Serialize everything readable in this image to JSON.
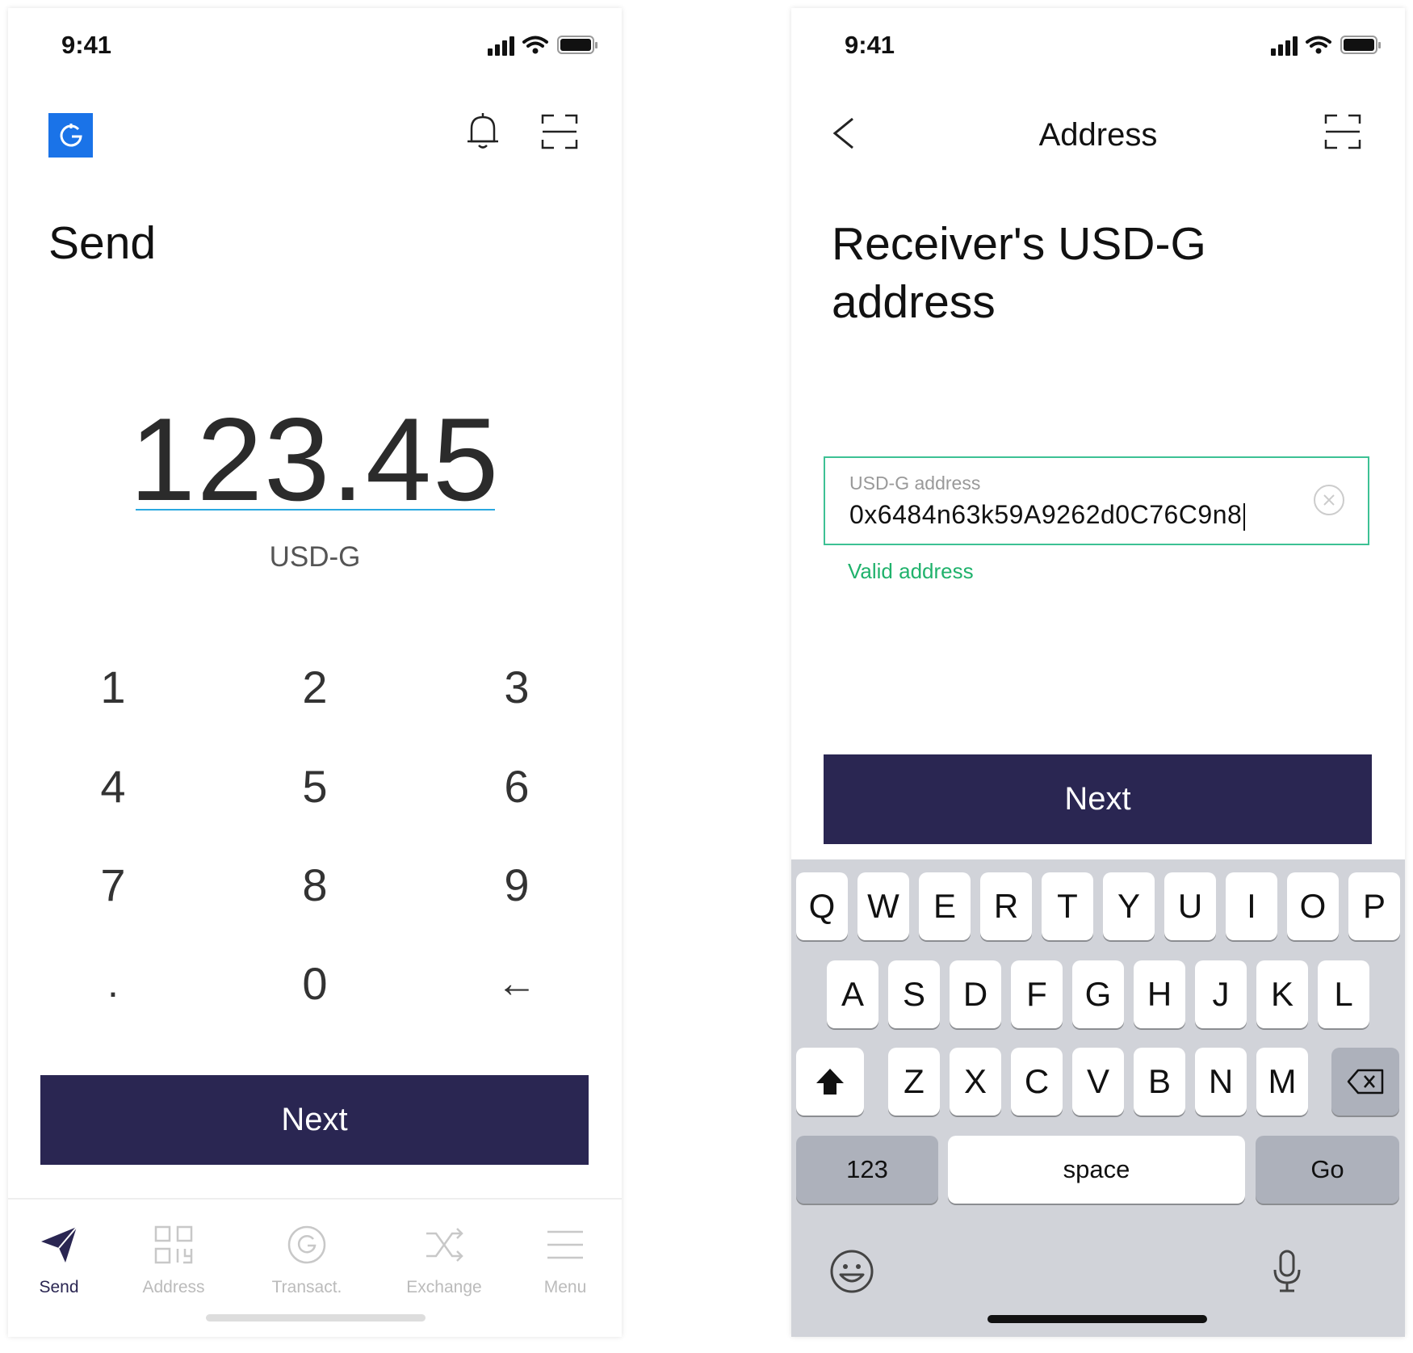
{
  "status": {
    "time": "9:41"
  },
  "left": {
    "title": "Send",
    "amount": "123.45",
    "currency": "USD-G",
    "keypad": [
      "1",
      "2",
      "3",
      "4",
      "5",
      "6",
      "7",
      "8",
      "9",
      ".",
      "0",
      "←"
    ],
    "next_label": "Next",
    "tabs": [
      {
        "label": "Send",
        "icon": "send-icon",
        "active": true
      },
      {
        "label": "Address",
        "icon": "qr-grid-icon",
        "active": false
      },
      {
        "label": "Transact.",
        "icon": "coin-icon",
        "active": false
      },
      {
        "label": "Exchange",
        "icon": "shuffle-icon",
        "active": false
      },
      {
        "label": "Menu",
        "icon": "menu-icon",
        "active": false
      }
    ]
  },
  "right": {
    "nav_title": "Address",
    "heading": "Receiver's USD-G address",
    "address_label": "USD-G address",
    "address_value": "0x6484n63k59A9262d0C76C9n8",
    "valid_message": "Valid address",
    "next_label": "Next",
    "keyboard": {
      "row1": [
        "Q",
        "W",
        "E",
        "R",
        "T",
        "Y",
        "U",
        "I",
        "O",
        "P"
      ],
      "row2": [
        "A",
        "S",
        "D",
        "F",
        "G",
        "H",
        "J",
        "K",
        "L"
      ],
      "row3": [
        "Z",
        "X",
        "C",
        "V",
        "B",
        "N",
        "M"
      ],
      "numbers_key": "123",
      "space_key": "space",
      "go_key": "Go"
    }
  },
  "colors": {
    "primary": "#2a2652",
    "logo_blue": "#1a73e8",
    "amount_underline": "#2aa8e0",
    "valid_green": "#20b26c",
    "field_border": "#3dc194",
    "keyboard_bg": "#d1d3d9"
  }
}
